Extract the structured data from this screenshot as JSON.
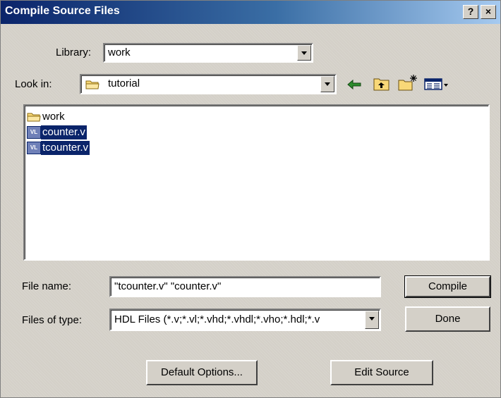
{
  "window": {
    "title": "Compile Source Files",
    "help_button": "?",
    "close_button": "×"
  },
  "library": {
    "label": "Library:",
    "value": "work"
  },
  "look_in": {
    "label": "Look in:",
    "value": "tutorial"
  },
  "files": [
    {
      "name": "work",
      "type": "folder",
      "selected": false
    },
    {
      "name": "counter.v",
      "type": "verilog",
      "selected": true
    },
    {
      "name": "tcounter.v",
      "type": "verilog",
      "selected": true
    }
  ],
  "file_name": {
    "label": "File name:",
    "value": "\"tcounter.v\" \"counter.v\""
  },
  "files_of_type": {
    "label": "Files of type:",
    "value": "HDL Files (*.v;*.vl;*.vhd;*.vhdl;*.vho;*.hdl;*.v"
  },
  "buttons": {
    "compile": "Compile",
    "done": "Done",
    "default_options": "Default Options...",
    "edit_source": "Edit Source"
  },
  "icons": {
    "verilog_badge": "VL"
  },
  "colors": {
    "title_bar": "#0a246a",
    "selection": "#0a246a",
    "dialog_bg": "#d4d0c8"
  }
}
